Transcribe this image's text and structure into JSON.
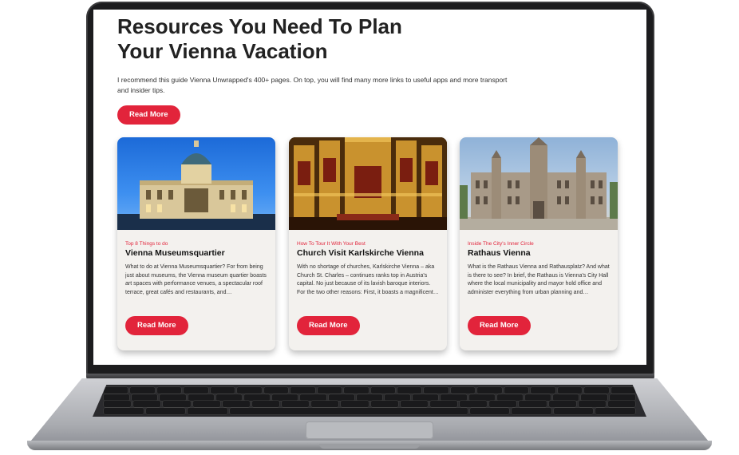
{
  "page": {
    "title": "Resources You Need To Plan\nYour Vienna Vacation",
    "intro": "I recommend this guide Vienna Unwrapped's 400+ pages. On top, you will find many more links to useful apps and more transport and insider tips.",
    "read_more_label": "Read More"
  },
  "cards": [
    {
      "tag": "Top 8 Things to do",
      "title": "Vienna Museumsquartier",
      "excerpt": "What to do at Vienna Museumsquartier? For from being just about museums, the Vienna museum quartier boasts art spaces with performance venues, a spectacular roof terrace, great cafés and restaurants, and…",
      "button": "Read More",
      "image_icon": "domed-building-icon"
    },
    {
      "tag": "How To Tour It With Your Best",
      "title": "Church Visit Karlskirche Vienna",
      "excerpt": "With no shortage of churches, Karlskirche Vienna – aka Church St. Charles – continues ranks top in Austria's capital. No just because of its lavish baroque interiors. For the two other reasons: First, it boasts a magnificent…",
      "button": "Read More",
      "image_icon": "church-interior-icon"
    },
    {
      "tag": "Inside The City's Inner Circle",
      "title": "Rathaus Vienna",
      "excerpt": "What is the Rathaus Vienna and Rathausplatz? And what is there to see? In brief, the Rathaus is Vienna's City Hall where the local municipality and mayor hold office and administer everything from urban planning and…",
      "button": "Read More",
      "image_icon": "city-hall-icon"
    }
  ],
  "colors": {
    "accent": "#e2243b",
    "card_bg": "#f3f1ee",
    "laptop_bezel": "#1c1c1e",
    "laptop_body": "#b9bbbf"
  }
}
